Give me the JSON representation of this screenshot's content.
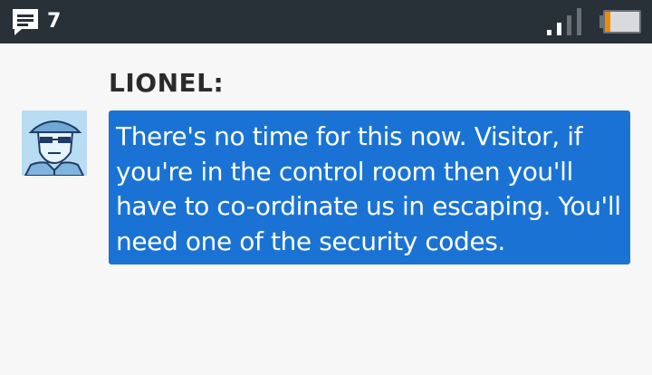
{
  "status_bar": {
    "notification_icon": "message-icon",
    "notification_count": "7",
    "signal_icon": "signal-strength-icon",
    "battery_icon": "battery-low-icon",
    "battery_level": 0.2,
    "battery_color": "#f08a00",
    "background": "#283038"
  },
  "dialogue": {
    "speaker_name": "LIONEL:",
    "avatar_icon": "character-portrait-icon",
    "message": "There's no time for this now. Visitor, if you're in the control room then you'll have to co-ordinate us in escaping. You'll need one of the security codes.",
    "bubble_color": "#1a73d4"
  }
}
